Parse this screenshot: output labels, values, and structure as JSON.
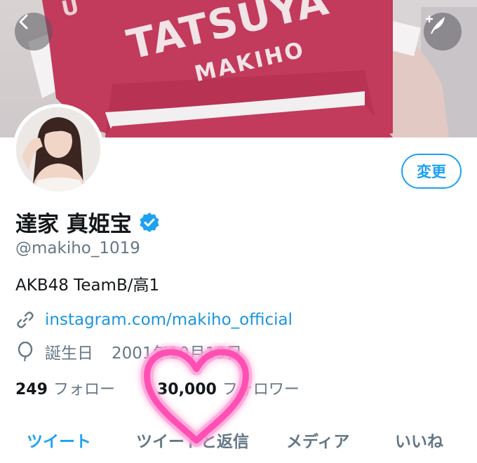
{
  "banner": {
    "text_top": "U",
    "text_main": "TATSUYA",
    "text_sub": "MAKIHO"
  },
  "header": {
    "back_icon": "chevron-left-icon",
    "compose_icon": "feather-plus-icon"
  },
  "profile": {
    "change_label": "変更",
    "display_name": "達家 真姫宝",
    "handle": "@makiho_1019",
    "bio": "AKB48 TeamB/高1",
    "link": "instagram.com/makiho_official",
    "birth_label": "誕生日",
    "birth_value": "2001年10月19日",
    "following_count": "249",
    "following_label": "フォロー",
    "followers_count": "30,000",
    "followers_label": "フォロワー"
  },
  "tabs": [
    {
      "label": "ツイート"
    },
    {
      "label": "ツイートと返信"
    },
    {
      "label": "メディア"
    },
    {
      "label": "いいね"
    }
  ],
  "colors": {
    "accent": "#1da1f2",
    "banner_shirt": "#c23a5c",
    "heart": "#ff4fb4"
  }
}
